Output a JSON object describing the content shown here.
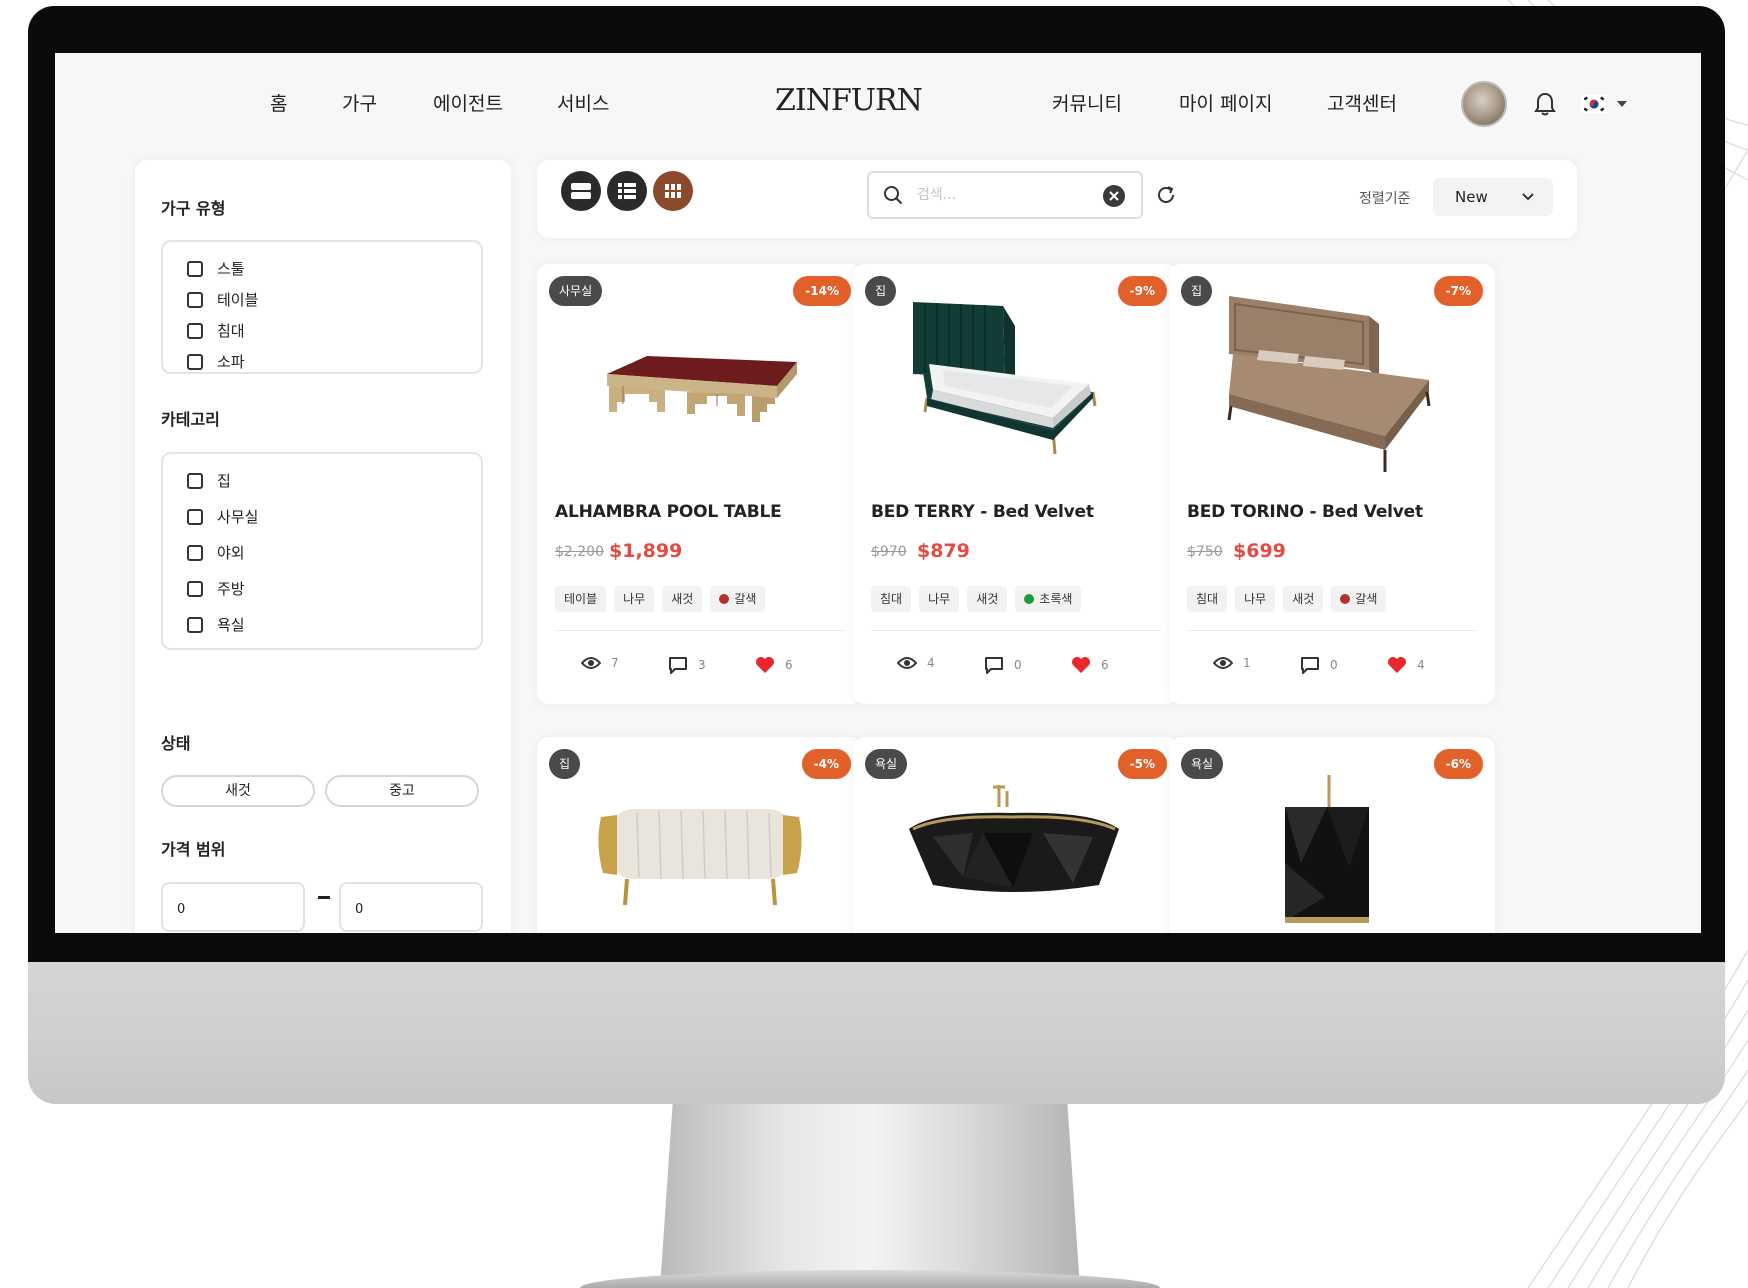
{
  "header": {
    "nav_left": [
      "홈",
      "가구",
      "에이전트",
      "서비스"
    ],
    "logo": "ZINFURN",
    "nav_right": [
      "커뮤니티",
      "마이 페이지",
      "고객센터"
    ]
  },
  "sidebar": {
    "furniture_type": {
      "title": "가구 유형",
      "options": [
        "스툴",
        "테이블",
        "침대",
        "소파"
      ]
    },
    "category": {
      "title": "카테고리",
      "options": [
        "집",
        "사무실",
        "야외",
        "주방",
        "욕실"
      ]
    },
    "condition": {
      "title": "상태",
      "options": [
        "새것",
        "중고"
      ]
    },
    "price_range": {
      "title": "가격 범위",
      "min": "0",
      "max": "0"
    }
  },
  "toolbar": {
    "search_placeholder": "검색...",
    "sort_label": "정렬기준",
    "sort_value": "New"
  },
  "products": [
    {
      "category": "사무실",
      "discount": "-14%",
      "name": "ALHAMBRA POOL TABLE",
      "old_price": "$2,200",
      "price": "$1,899",
      "tags": [
        "테이블",
        "나무",
        "새것"
      ],
      "color_tag": "갈색",
      "color_hex": "#b5312b",
      "views": "7",
      "comments": "3",
      "likes": "6"
    },
    {
      "category": "집",
      "discount": "-9%",
      "name": "BED TERRY - Bed Velvet",
      "old_price": "$970",
      "price": "$879",
      "tags": [
        "침대",
        "나무",
        "새것"
      ],
      "color_tag": "초록색",
      "color_hex": "#1f9a3b",
      "views": "4",
      "comments": "0",
      "likes": "6"
    },
    {
      "category": "집",
      "discount": "-7%",
      "name": "BED TORINO - Bed Velvet",
      "old_price": "$750",
      "price": "$699",
      "tags": [
        "침대",
        "나무",
        "새것"
      ],
      "color_tag": "갈색",
      "color_hex": "#b5312b",
      "views": "1",
      "comments": "0",
      "likes": "4"
    },
    {
      "category": "집",
      "discount": "-4%"
    },
    {
      "category": "욕실",
      "discount": "-5%"
    },
    {
      "category": "욕실",
      "discount": "-6%"
    }
  ],
  "colors": {
    "accent": "#e2612a",
    "active_view": "#8b4a2b",
    "price": "#e34b43",
    "like": "#e8262b"
  }
}
